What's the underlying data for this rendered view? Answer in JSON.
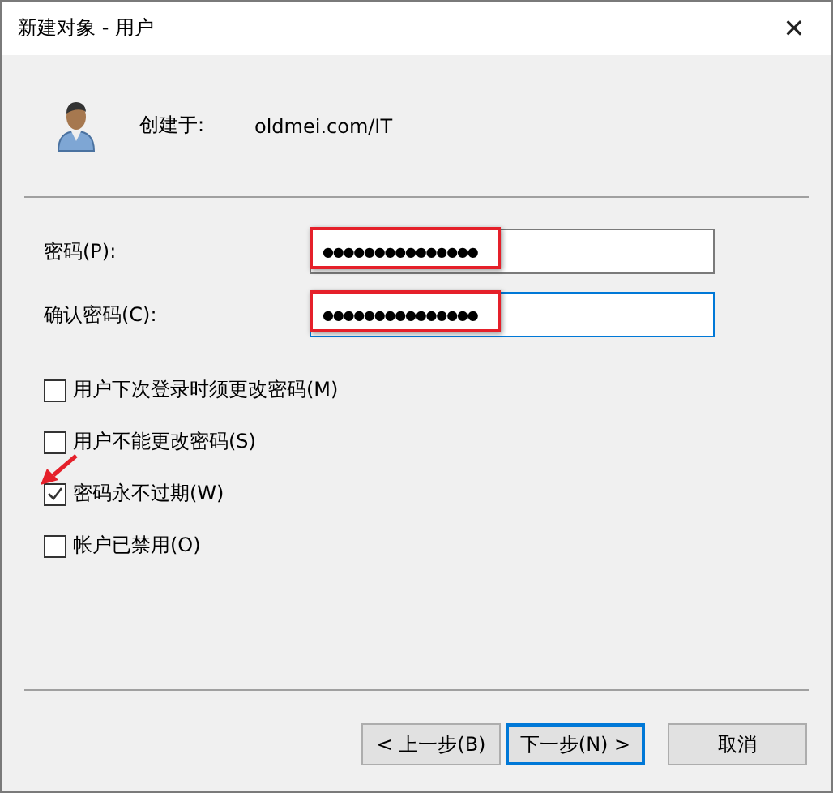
{
  "window": {
    "title": "新建对象 - 用户",
    "close": "✕"
  },
  "created_in": {
    "label": "创建于:",
    "value": "oldmei.com/IT"
  },
  "fields": [
    {
      "label": "密码(P):",
      "value": "●●●●●●●●●●●●●●●",
      "focused": false,
      "highlighted": true
    },
    {
      "label": "确认密码(C):",
      "value": "●●●●●●●●●●●●●●●",
      "focused": true,
      "highlighted": true
    }
  ],
  "checkboxes": [
    {
      "label": "用户下次登录时须更改密码(M)",
      "checked": false,
      "pointed": false
    },
    {
      "label": "用户不能更改密码(S)",
      "checked": false,
      "pointed": false
    },
    {
      "label": "密码永不过期(W)",
      "checked": true,
      "pointed": true
    },
    {
      "label": "帐户已禁用(O)",
      "checked": false,
      "pointed": false
    }
  ],
  "buttons": [
    {
      "label": "< 上一步(B)",
      "default": false
    },
    {
      "label": "下一步(N) >",
      "default": true
    },
    {
      "label": "取消",
      "default": false
    }
  ]
}
